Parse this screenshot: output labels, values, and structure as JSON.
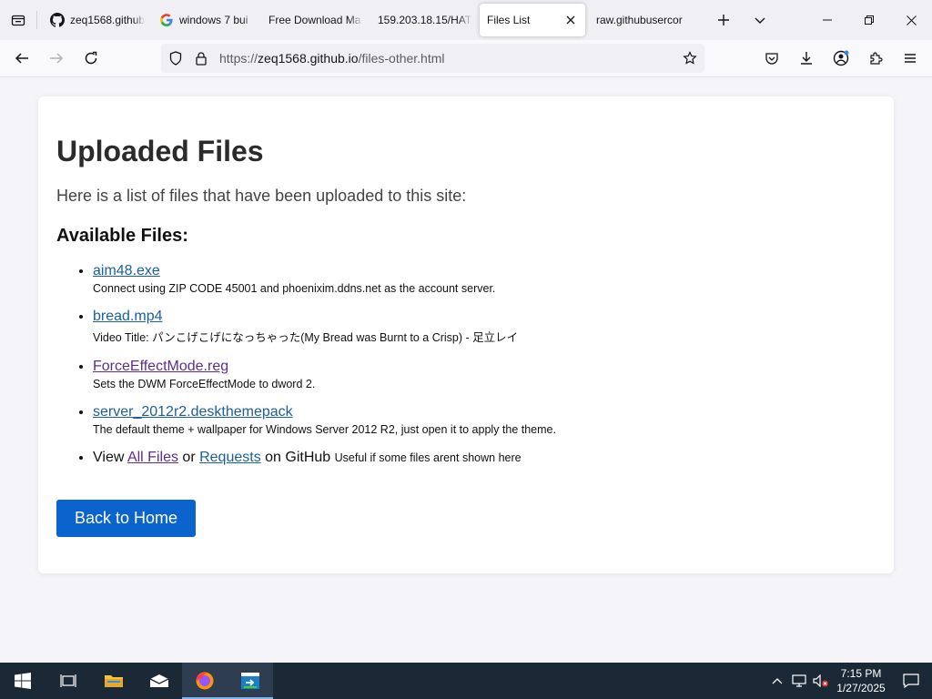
{
  "browser": {
    "tabs": [
      {
        "label": "zeq1568.github",
        "icon": "github-icon"
      },
      {
        "label": "windows 7 bui",
        "icon": "google-icon"
      },
      {
        "label": "Free Download Ma",
        "icon": "none"
      },
      {
        "label": "159.203.18.15/HATI",
        "icon": "none"
      },
      {
        "label": "Files List",
        "icon": "none",
        "active": true
      },
      {
        "label": "raw.githubusercor",
        "icon": "none"
      }
    ],
    "url_prefix": "https://",
    "url_host": "zeq1568.github.io",
    "url_path": "/files-other.html"
  },
  "page": {
    "title": "Uploaded Files",
    "intro": "Here is a list of files that have been uploaded to this site:",
    "section_title": "Available Files:",
    "files": [
      {
        "name": "aim48.exe",
        "desc": "Connect using ZIP CODE 45001 and phoenixim.ddns.net as the account server.",
        "visited": false
      },
      {
        "name": "bread.mp4",
        "desc": "Video Title: パンこげこげになっちゃった(My Bread was Burnt to a Crisp) - 足立レイ",
        "visited": false
      },
      {
        "name": "ForceEffectMode.reg",
        "desc": "Sets the DWM ForceEffectMode to dword 2.",
        "visited": true
      },
      {
        "name": "server_2012r2.deskthemepack",
        "desc": "The default theme + wallpaper for Windows Server 2012 R2, just open it to apply the theme.",
        "visited": false
      }
    ],
    "view_prefix": "View ",
    "view_all": "All Files",
    "view_or": " or ",
    "view_requests": "Requests",
    "view_suffix": " on GitHub ",
    "view_note": "Useful if some files arent shown here",
    "home_button": "Back to Home"
  },
  "taskbar": {
    "time": "7:15 PM",
    "date": "1/27/2025"
  },
  "colors": {
    "link": "#1a5fa0",
    "visited": "#5c2d91",
    "button": "#0b63ce",
    "taskbar": "#1b2836"
  }
}
